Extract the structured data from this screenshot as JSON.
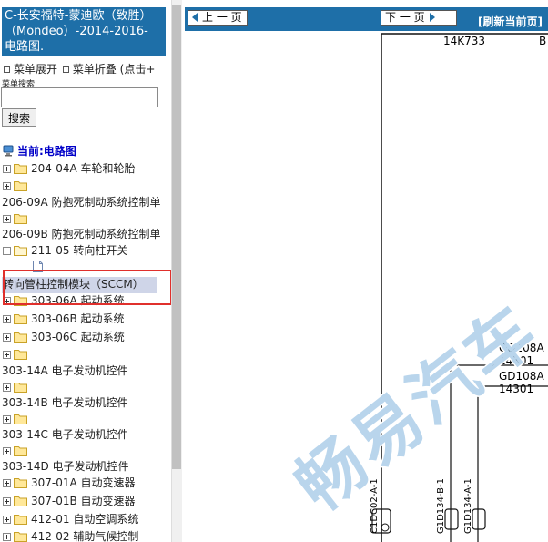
{
  "sidebar": {
    "title": "C-长安福特-蒙迪欧（致胜）（Mondeo）-2014-2016- 电路图.",
    "menu_expand": "菜单展开",
    "menu_collapse": "菜单折叠 (点击+",
    "search_label": "菜单搜索",
    "search_value": "",
    "search_button": "搜索",
    "current_label": "当前:电路图",
    "tree": [
      {
        "label": "204-04A 车轮和轮胎",
        "expanded": false
      },
      {
        "label": "",
        "expanded": false
      },
      {
        "label": "206-09A 防抱死制动系统控制单",
        "wrapped": true
      },
      {
        "label": "",
        "expanded": false
      },
      {
        "label": "206-09B 防抱死制动系统控制单",
        "wrapped": true
      },
      {
        "label": "211-05 转向柱开关",
        "expanded": true
      },
      {
        "label": "转向管柱控制模块（SCCM）",
        "selected": true
      },
      {
        "label": "303-06A 起动系统"
      },
      {
        "label": "303-06B 起动系统"
      },
      {
        "label": "303-06C 起动系统"
      },
      {
        "label": ""
      },
      {
        "label": "303-14A 电子发动机控件",
        "wrapped": true
      },
      {
        "label": ""
      },
      {
        "label": "303-14B 电子发动机控件",
        "wrapped": true
      },
      {
        "label": ""
      },
      {
        "label": "303-14C 电子发动机控件",
        "wrapped": true
      },
      {
        "label": ""
      },
      {
        "label": "303-14D 电子发动机控件",
        "wrapped": true
      },
      {
        "label": "307-01A 自动变速器"
      },
      {
        "label": "307-01B 自动变速器"
      },
      {
        "label": "412-01 自动空调系统"
      },
      {
        "label": "412-02 辅助气候控制"
      }
    ]
  },
  "toolbar": {
    "prev_label": "上 一 页",
    "next_label": "下 一 页",
    "refresh_label": "[刷新当前页]"
  },
  "diagram": {
    "top_label_1": "14K733",
    "top_label_2": "B",
    "wire_1": "GD108A",
    "wire_1_num": "14301",
    "wire_2": "GD108A",
    "wire_2_num": "14301",
    "conn_1": "C1DC02-A-1",
    "conn_2": "G1D134-B-1",
    "conn_3": "G1D134-A-1",
    "watermark": "畅易汽车"
  },
  "colors": {
    "header_blue": "#1e6fa8",
    "highlight_red": "#e0302c",
    "link_blue": "#0000c8"
  }
}
